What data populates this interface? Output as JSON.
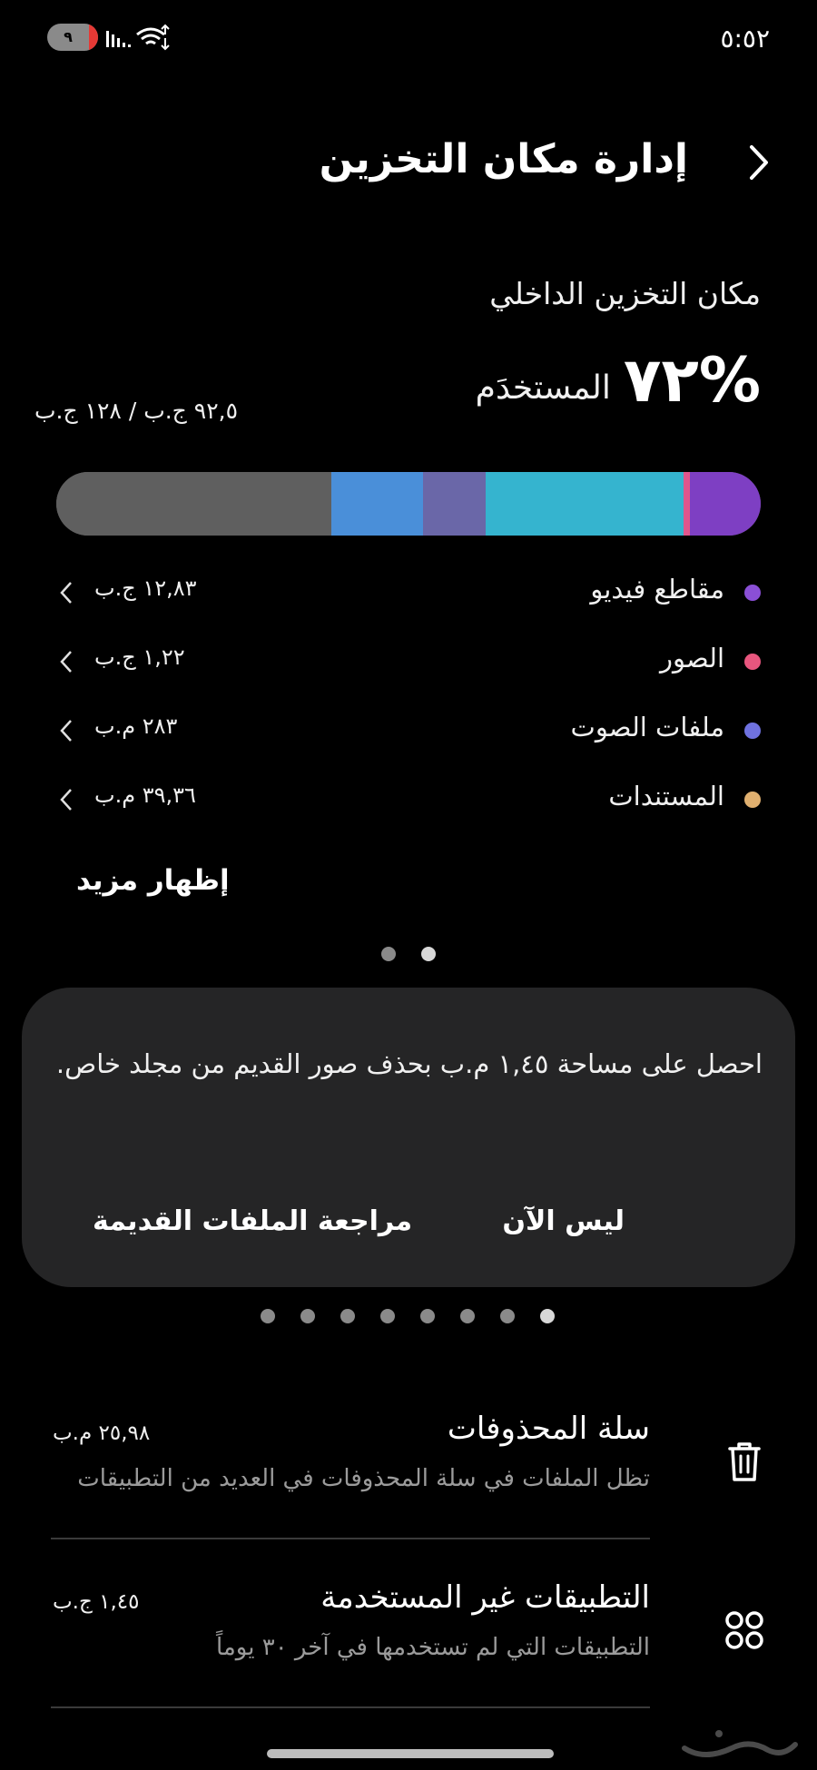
{
  "status": {
    "time": "٥:٥٢",
    "battery_level": "٩"
  },
  "header": {
    "title": "إدارة مكان التخزين"
  },
  "storage": {
    "label": "مكان التخزين الداخلي",
    "used_percent": "%٧٢",
    "used_label": "المستخدَم",
    "used_amount": "٩٢,٥ ج.ب / ١٢٨ ج.ب",
    "used_fraction": 0.72,
    "segments": [
      {
        "name": "videos",
        "color": "#7e3fc3",
        "fraction": 0.1
      },
      {
        "name": "images",
        "color": "#e0568c",
        "fraction": 0.01
      },
      {
        "name": "apps",
        "color": "#35b4cf",
        "fraction": 0.28
      },
      {
        "name": "system",
        "color": "#6a67a8",
        "fraction": 0.09
      },
      {
        "name": "other",
        "color": "#4a8fd9",
        "fraction": 0.13
      },
      {
        "name": "free",
        "color": "#5f5f5f",
        "fraction": 0.39
      }
    ]
  },
  "categories": [
    {
      "name": "مقاطع فيديو",
      "size": "١٢,٨٣ ج.ب",
      "color": "#8a4fd6"
    },
    {
      "name": "الصور",
      "size": "١,٢٢ ج.ب",
      "color": "#e8567e"
    },
    {
      "name": "ملفات الصوت",
      "size": "٢٨٣ م.ب",
      "color": "#6f72e0"
    },
    {
      "name": "المستندات",
      "size": "٣٩,٣٦ م.ب",
      "color": "#e0b070"
    }
  ],
  "show_more": "إظهار مزيد",
  "card": {
    "text": "احصل على مساحة ١,٤٥ م.ب بحذف صور القديم من مجلد خاص.",
    "not_now": "ليس الآن",
    "review": "مراجعة الملفات القديمة"
  },
  "tools": [
    {
      "title": "سلة المحذوفات",
      "subtitle": "تظل الملفات في سلة المحذوفات في العديد من التطبيقات",
      "size": "٢٥,٩٨ م.ب",
      "icon": "trash-icon"
    },
    {
      "title": "التطبيقات غير المستخدمة",
      "subtitle": "التطبيقات التي لم تستخدمها في آخر ٣٠ يوماً",
      "size": "١,٤٥ ج.ب",
      "icon": "apps-grid-icon"
    }
  ]
}
